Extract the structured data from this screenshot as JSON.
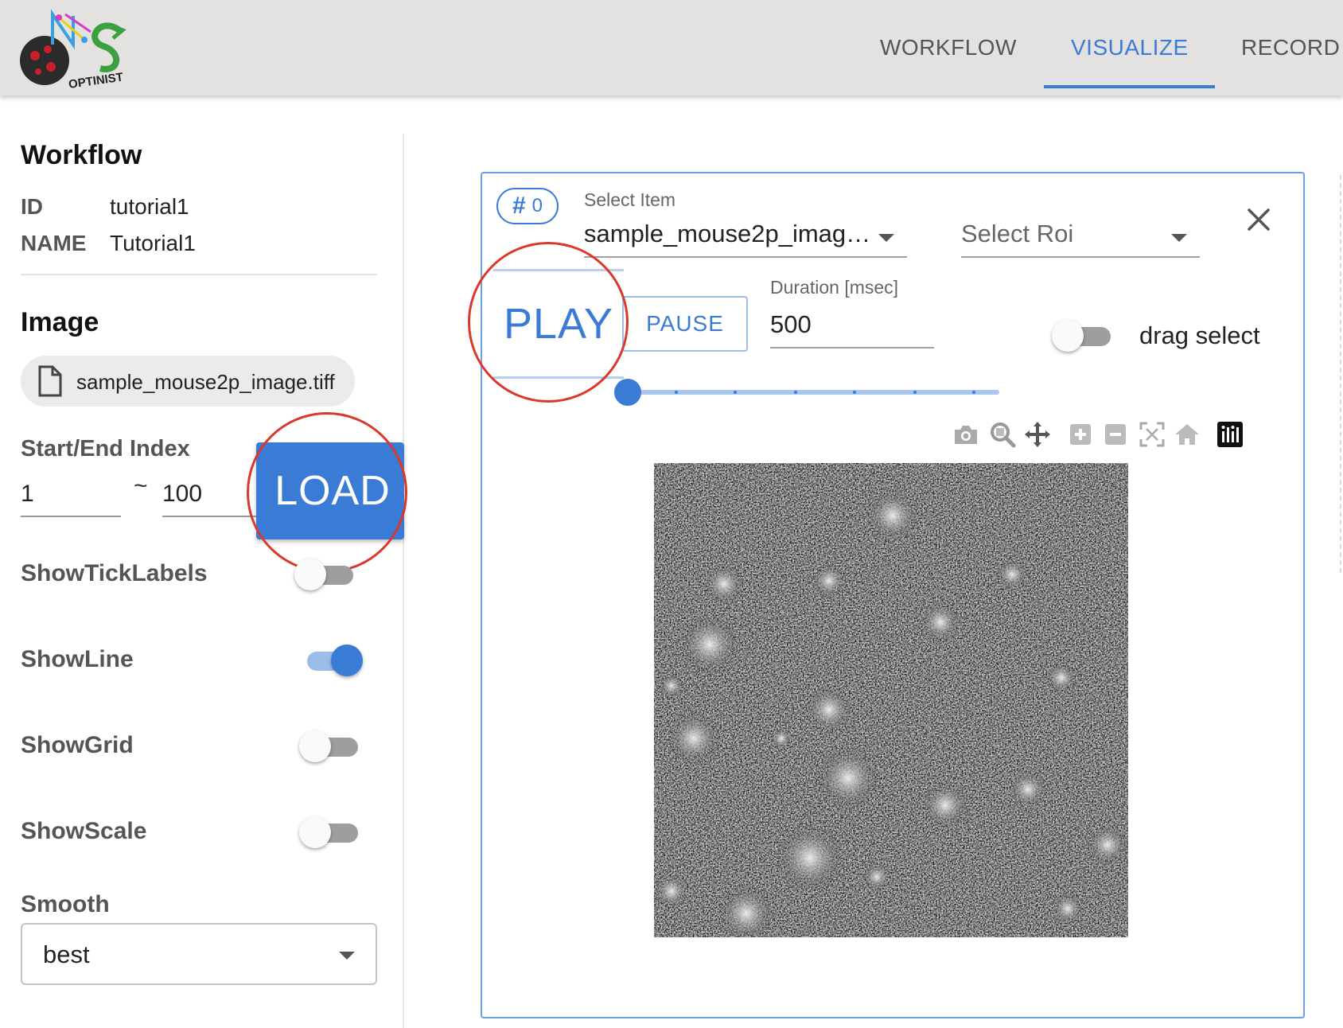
{
  "header": {
    "logo_text": "OPTINIST",
    "tabs": [
      {
        "label": "WORKFLOW"
      },
      {
        "label": "VISUALIZE"
      },
      {
        "label": "RECORD"
      }
    ]
  },
  "sidebar": {
    "workflow_title": "Workflow",
    "id_key": "ID",
    "id_value": "tutorial1",
    "name_key": "NAME",
    "name_value": "Tutorial1",
    "image_title": "Image",
    "file_name": "sample_mouse2p_image.tiff",
    "index_label": "Start/End Index",
    "start_index": "1",
    "separator": "~",
    "end_index": "100",
    "load_label": "LOAD",
    "options": [
      {
        "label": "ShowTickLabels",
        "on": false
      },
      {
        "label": "ShowLine",
        "on": true
      },
      {
        "label": "ShowGrid",
        "on": false
      },
      {
        "label": "ShowScale",
        "on": false
      }
    ],
    "smooth_label": "Smooth",
    "smooth_value": "best"
  },
  "viewer": {
    "hash": "#",
    "item_number": "0",
    "select_item_label": "Select Item",
    "select_item_value": "sample_mouse2p_imag…",
    "select_roi_placeholder": "Select Roi",
    "play_label": "PLAY",
    "pause_label": "PAUSE",
    "duration_label": "Duration [msec]",
    "duration_value": "500",
    "drag_select_label": "drag select",
    "drag_select_on": false,
    "slider_position": 0,
    "toolbar_icons": [
      "camera-icon",
      "zoom-icon",
      "pan-icon",
      "zoom-in-icon",
      "zoom-out-icon",
      "autoscale-icon",
      "reset-home-icon",
      "plotly-logo-icon"
    ]
  },
  "colors": {
    "accent": "#3a7bd5",
    "highlight_ring": "#d9392b",
    "header_bg": "#e4e2e1"
  }
}
